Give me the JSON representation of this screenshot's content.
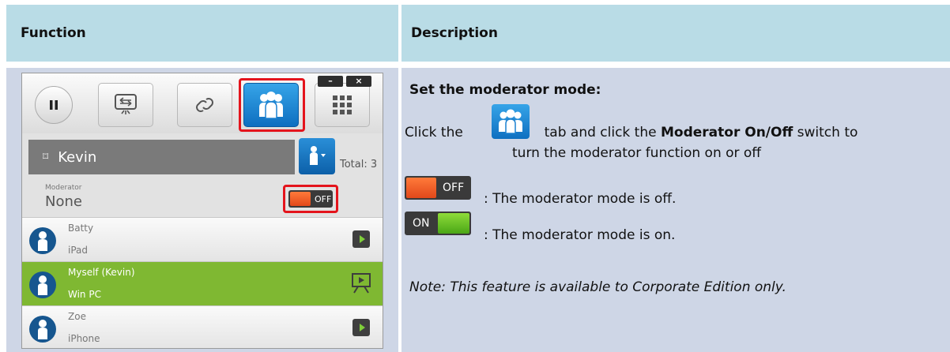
{
  "table": {
    "header_function": "Function",
    "header_description": "Description"
  },
  "app": {
    "window_minimize": "–",
    "window_close": "×",
    "toolbar_icons": [
      "pause-icon",
      "screen-share-icon",
      "link-icon",
      "participants-icon",
      "grid-icon"
    ],
    "user_name": "Kevin",
    "total_label": "Total: 3",
    "moderator_label": "Moderator",
    "moderator_value": "None",
    "moderator_switch": "OFF",
    "participants": [
      {
        "name": "Batty",
        "device": "iPad"
      },
      {
        "name": "Myself (Kevin)",
        "device": "Win PC"
      },
      {
        "name": "Zoe",
        "device": "iPhone"
      }
    ]
  },
  "description": {
    "title": "Set the moderator mode:",
    "line1_pre": "Click the",
    "line1_mid": "tab and click the",
    "line1_bold": "Moderator On/Off",
    "line1_post": "switch to",
    "line2": "turn the moderator function on or off",
    "switch_off_label": "OFF",
    "switch_on_label": "ON",
    "off_text": ": The moderator mode is off.",
    "on_text": ": The moderator mode is on.",
    "note": "Note: This feature is available to Corporate Edition only."
  },
  "colors": {
    "header_bg": "#b9dce6",
    "cell_bg": "#ced6e6",
    "highlight": "#e4141c",
    "active_row": "#7fb832",
    "accent_blue": "#0e6fc0"
  }
}
